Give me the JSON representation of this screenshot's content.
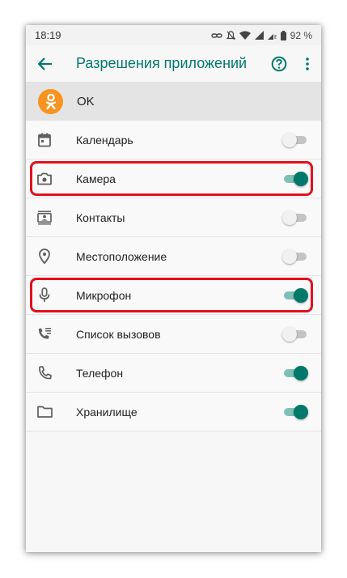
{
  "status": {
    "time": "18:19",
    "battery": "92 %"
  },
  "appbar": {
    "title": "Разрешения приложений"
  },
  "app": {
    "name": "OK",
    "brand_color": "#f7931e"
  },
  "accent_color": "#00796b",
  "highlight_color": "#e2101d",
  "permissions": [
    {
      "label": "Календарь",
      "icon": "calendar-icon",
      "enabled": false,
      "highlighted": false
    },
    {
      "label": "Камера",
      "icon": "camera-icon",
      "enabled": true,
      "highlighted": true
    },
    {
      "label": "Контакты",
      "icon": "contacts-icon",
      "enabled": false,
      "highlighted": false
    },
    {
      "label": "Местоположение",
      "icon": "location-icon",
      "enabled": false,
      "highlighted": false
    },
    {
      "label": "Микрофон",
      "icon": "microphone-icon",
      "enabled": true,
      "highlighted": true
    },
    {
      "label": "Список вызовов",
      "icon": "call-log-icon",
      "enabled": false,
      "highlighted": false
    },
    {
      "label": "Телефон",
      "icon": "phone-icon",
      "enabled": true,
      "highlighted": false
    },
    {
      "label": "Хранилище",
      "icon": "folder-icon",
      "enabled": true,
      "highlighted": false
    }
  ]
}
